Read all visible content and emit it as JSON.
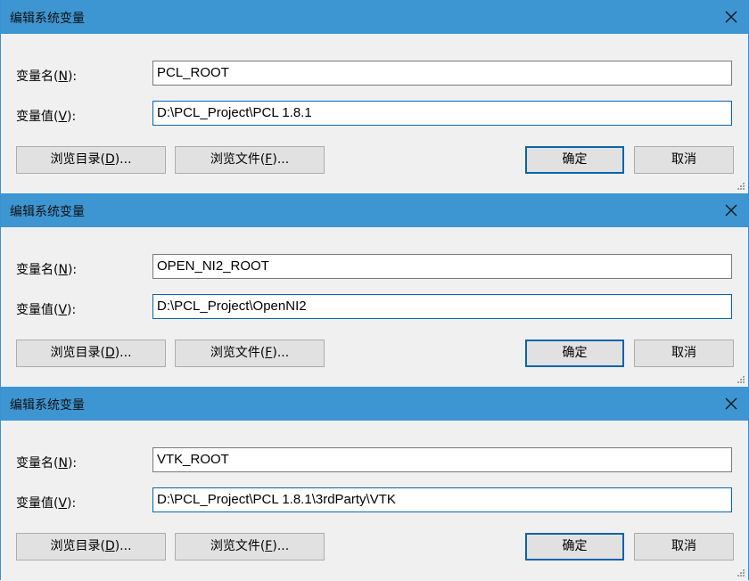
{
  "dialogs": [
    {
      "title": "编辑系统变量",
      "name_label": "变量名(",
      "name_key": "N",
      "name_close": "):",
      "value_label": "变量值(",
      "value_key": "V",
      "value_close": "):",
      "name_value": "PCL_ROOT",
      "value_value": "D:\\PCL_Project\\PCL 1.8.1",
      "browse_dir_pre": "浏览目录(",
      "browse_dir_key": "D",
      "browse_dir_post": ")...",
      "browse_file_pre": "浏览文件(",
      "browse_file_key": "F",
      "browse_file_post": ")...",
      "ok_label": "确定",
      "cancel_label": "取消"
    },
    {
      "title": "编辑系统变量",
      "name_label": "变量名(",
      "name_key": "N",
      "name_close": "):",
      "value_label": "变量值(",
      "value_key": "V",
      "value_close": "):",
      "name_value": "OPEN_NI2_ROOT",
      "value_value": "D:\\PCL_Project\\OpenNI2",
      "browse_dir_pre": "浏览目录(",
      "browse_dir_key": "D",
      "browse_dir_post": ")...",
      "browse_file_pre": "浏览文件(",
      "browse_file_key": "F",
      "browse_file_post": ")...",
      "ok_label": "确定",
      "cancel_label": "取消"
    },
    {
      "title": "编辑系统变量",
      "name_label": "变量名(",
      "name_key": "N",
      "name_close": "):",
      "value_label": "变量值(",
      "value_key": "V",
      "value_close": "):",
      "name_value": "VTK_ROOT",
      "value_value": "D:\\PCL_Project\\PCL 1.8.1\\3rdParty\\VTK",
      "browse_dir_pre": "浏览目录(",
      "browse_dir_key": "D",
      "browse_dir_post": ")...",
      "browse_file_pre": "浏览文件(",
      "browse_file_key": "F",
      "browse_file_post": ")...",
      "ok_label": "确定",
      "cancel_label": "取消"
    }
  ],
  "icons": {
    "close": "close-icon",
    "grip": "resize-grip-icon"
  },
  "colors": {
    "titlebar": "#3d96d2",
    "focus_border": "#0a64ad",
    "button_bg": "#e1e1e1"
  }
}
